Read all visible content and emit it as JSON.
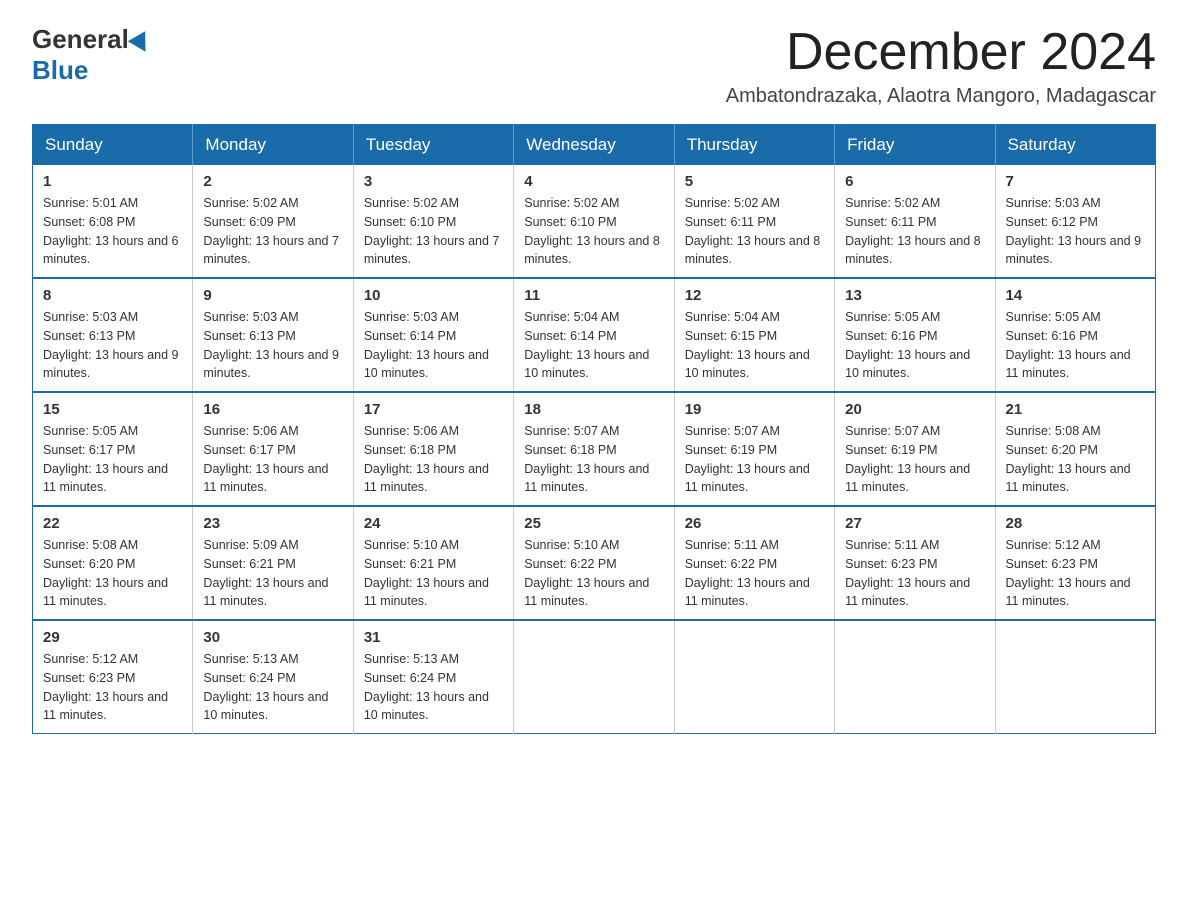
{
  "logo": {
    "general": "General",
    "blue": "Blue"
  },
  "title": "December 2024",
  "subtitle": "Ambatondrazaka, Alaotra Mangoro, Madagascar",
  "days_of_week": [
    "Sunday",
    "Monday",
    "Tuesday",
    "Wednesday",
    "Thursday",
    "Friday",
    "Saturday"
  ],
  "weeks": [
    [
      {
        "day": "1",
        "sunrise": "5:01 AM",
        "sunset": "6:08 PM",
        "daylight": "13 hours and 6 minutes."
      },
      {
        "day": "2",
        "sunrise": "5:02 AM",
        "sunset": "6:09 PM",
        "daylight": "13 hours and 7 minutes."
      },
      {
        "day": "3",
        "sunrise": "5:02 AM",
        "sunset": "6:10 PM",
        "daylight": "13 hours and 7 minutes."
      },
      {
        "day": "4",
        "sunrise": "5:02 AM",
        "sunset": "6:10 PM",
        "daylight": "13 hours and 8 minutes."
      },
      {
        "day": "5",
        "sunrise": "5:02 AM",
        "sunset": "6:11 PM",
        "daylight": "13 hours and 8 minutes."
      },
      {
        "day": "6",
        "sunrise": "5:02 AM",
        "sunset": "6:11 PM",
        "daylight": "13 hours and 8 minutes."
      },
      {
        "day": "7",
        "sunrise": "5:03 AM",
        "sunset": "6:12 PM",
        "daylight": "13 hours and 9 minutes."
      }
    ],
    [
      {
        "day": "8",
        "sunrise": "5:03 AM",
        "sunset": "6:13 PM",
        "daylight": "13 hours and 9 minutes."
      },
      {
        "day": "9",
        "sunrise": "5:03 AM",
        "sunset": "6:13 PM",
        "daylight": "13 hours and 9 minutes."
      },
      {
        "day": "10",
        "sunrise": "5:03 AM",
        "sunset": "6:14 PM",
        "daylight": "13 hours and 10 minutes."
      },
      {
        "day": "11",
        "sunrise": "5:04 AM",
        "sunset": "6:14 PM",
        "daylight": "13 hours and 10 minutes."
      },
      {
        "day": "12",
        "sunrise": "5:04 AM",
        "sunset": "6:15 PM",
        "daylight": "13 hours and 10 minutes."
      },
      {
        "day": "13",
        "sunrise": "5:05 AM",
        "sunset": "6:16 PM",
        "daylight": "13 hours and 10 minutes."
      },
      {
        "day": "14",
        "sunrise": "5:05 AM",
        "sunset": "6:16 PM",
        "daylight": "13 hours and 11 minutes."
      }
    ],
    [
      {
        "day": "15",
        "sunrise": "5:05 AM",
        "sunset": "6:17 PM",
        "daylight": "13 hours and 11 minutes."
      },
      {
        "day": "16",
        "sunrise": "5:06 AM",
        "sunset": "6:17 PM",
        "daylight": "13 hours and 11 minutes."
      },
      {
        "day": "17",
        "sunrise": "5:06 AM",
        "sunset": "6:18 PM",
        "daylight": "13 hours and 11 minutes."
      },
      {
        "day": "18",
        "sunrise": "5:07 AM",
        "sunset": "6:18 PM",
        "daylight": "13 hours and 11 minutes."
      },
      {
        "day": "19",
        "sunrise": "5:07 AM",
        "sunset": "6:19 PM",
        "daylight": "13 hours and 11 minutes."
      },
      {
        "day": "20",
        "sunrise": "5:07 AM",
        "sunset": "6:19 PM",
        "daylight": "13 hours and 11 minutes."
      },
      {
        "day": "21",
        "sunrise": "5:08 AM",
        "sunset": "6:20 PM",
        "daylight": "13 hours and 11 minutes."
      }
    ],
    [
      {
        "day": "22",
        "sunrise": "5:08 AM",
        "sunset": "6:20 PM",
        "daylight": "13 hours and 11 minutes."
      },
      {
        "day": "23",
        "sunrise": "5:09 AM",
        "sunset": "6:21 PM",
        "daylight": "13 hours and 11 minutes."
      },
      {
        "day": "24",
        "sunrise": "5:10 AM",
        "sunset": "6:21 PM",
        "daylight": "13 hours and 11 minutes."
      },
      {
        "day": "25",
        "sunrise": "5:10 AM",
        "sunset": "6:22 PM",
        "daylight": "13 hours and 11 minutes."
      },
      {
        "day": "26",
        "sunrise": "5:11 AM",
        "sunset": "6:22 PM",
        "daylight": "13 hours and 11 minutes."
      },
      {
        "day": "27",
        "sunrise": "5:11 AM",
        "sunset": "6:23 PM",
        "daylight": "13 hours and 11 minutes."
      },
      {
        "day": "28",
        "sunrise": "5:12 AM",
        "sunset": "6:23 PM",
        "daylight": "13 hours and 11 minutes."
      }
    ],
    [
      {
        "day": "29",
        "sunrise": "5:12 AM",
        "sunset": "6:23 PM",
        "daylight": "13 hours and 11 minutes."
      },
      {
        "day": "30",
        "sunrise": "5:13 AM",
        "sunset": "6:24 PM",
        "daylight": "13 hours and 10 minutes."
      },
      {
        "day": "31",
        "sunrise": "5:13 AM",
        "sunset": "6:24 PM",
        "daylight": "13 hours and 10 minutes."
      },
      null,
      null,
      null,
      null
    ]
  ],
  "labels": {
    "sunrise": "Sunrise:",
    "sunset": "Sunset:",
    "daylight": "Daylight:"
  }
}
